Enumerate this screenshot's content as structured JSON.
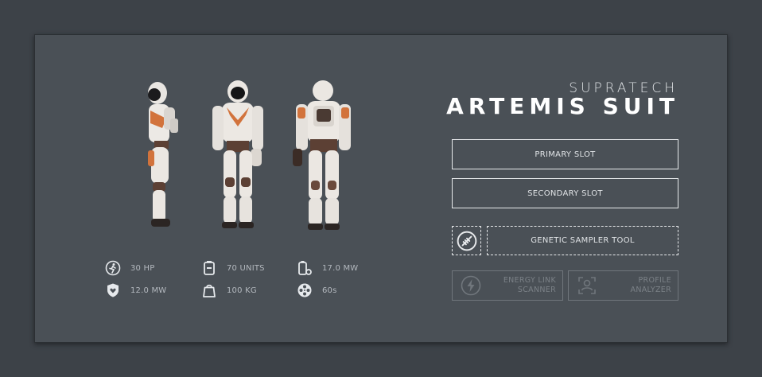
{
  "suit": {
    "brand": "SUPRATECH",
    "name": "ARTEMIS SUIT"
  },
  "stats": [
    {
      "icon": "running-figure-icon",
      "value": "30 HP"
    },
    {
      "icon": "battery-icon",
      "value": "70 UNITS"
    },
    {
      "icon": "battery-gear-icon",
      "value": "17.0 MW"
    },
    {
      "icon": "shield-heart-icon",
      "value": "12.0 MW"
    },
    {
      "icon": "weight-icon",
      "value": "100 KG"
    },
    {
      "icon": "reel-icon",
      "value": "60s"
    }
  ],
  "slots": {
    "primary": "PRIMARY SLOT",
    "secondary": "SECONDARY SLOT"
  },
  "tool": {
    "icon": "genetic-sampler-icon",
    "label": "GENETIC SAMPLER TOOL"
  },
  "actions": {
    "energy_line1": "ENERGY LINK",
    "energy_line2": "SCANNER",
    "profile_line1": "PROFILE",
    "profile_line2": "ANALYZER"
  },
  "colors": {
    "background": "#3d4248",
    "panel": "#4a5056",
    "suit_white": "#e9e6e2",
    "suit_orange": "#d2733c",
    "suit_brown": "#5c4034",
    "disabled": "#7b8187"
  }
}
